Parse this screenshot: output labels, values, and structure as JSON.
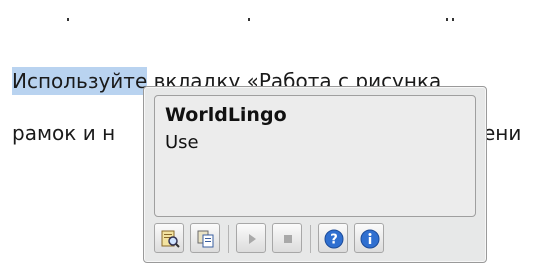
{
  "document": {
    "line1_highlighted": "Используйте",
    "line1_rest": " вкладку «Работа с рисунка",
    "line2_left": "рамок и н",
    "line2_right": "ени"
  },
  "popup": {
    "title": "WorldLingo",
    "subtitle": "Use"
  },
  "toolbar": {
    "buttons": [
      {
        "name": "lookup-icon"
      },
      {
        "name": "copy-icon"
      },
      {
        "name": "play-icon"
      },
      {
        "name": "stop-icon"
      },
      {
        "name": "help-icon"
      },
      {
        "name": "info-icon"
      }
    ]
  },
  "colors": {
    "highlight": "#b9d3f0",
    "popup_bg": "#e7e8e8",
    "icon_blue": "#2f6fd0"
  }
}
